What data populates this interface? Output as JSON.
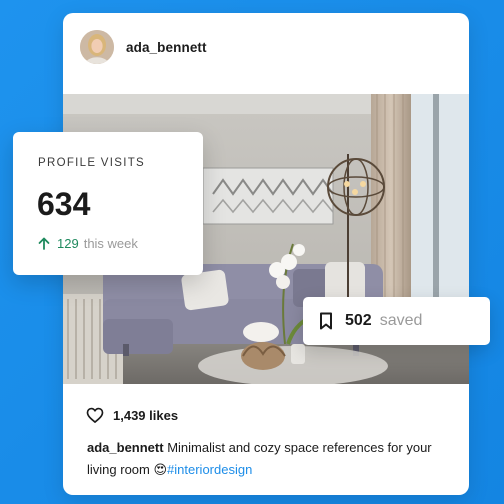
{
  "post": {
    "username": "ada_bennett",
    "likes": "1,439 likes",
    "caption_user": "ada_bennett",
    "caption_text": " Minimalist and cozy space references for your living room ",
    "caption_emoji": "😍",
    "hashtag": "#interiordesign"
  },
  "profile_visits": {
    "label": "PROFILE VISITS",
    "count": "634",
    "delta": "129",
    "period": "this week"
  },
  "saved": {
    "count": "502",
    "label": "saved"
  },
  "colors": {
    "background": "#1a8fe8",
    "positive": "#1f8a5e",
    "hashtag": "#1d8de8"
  },
  "icons": {
    "likes": "heart-icon",
    "delta": "arrow-up-icon",
    "saved": "bookmark-icon"
  }
}
